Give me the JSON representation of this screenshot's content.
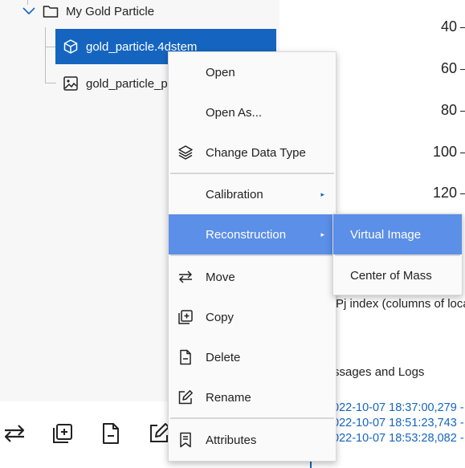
{
  "tree": {
    "root_label": "My Gold Particle",
    "items": [
      {
        "label": "gold_particle.4dstem",
        "icon": "cube-icon",
        "selected": true
      },
      {
        "label": "gold_particle_pr",
        "icon": "image-icon",
        "selected": false
      }
    ]
  },
  "toolbar": {
    "buttons": [
      {
        "icon": "move-arrows-icon"
      },
      {
        "icon": "copy-add-icon"
      },
      {
        "icon": "delete-file-icon"
      },
      {
        "icon": "rename-pen-icon"
      }
    ]
  },
  "axis": {
    "ticks": [
      "40",
      "60",
      "80",
      "100",
      "120"
    ],
    "caption": "Pj index (columns of loca"
  },
  "messages": {
    "title": "ssages and Logs",
    "lines": [
      "022-10-07 18:37:00,279 -",
      "022-10-07 18:51:23,743 -",
      "022-10-07 18:53:28,082 -"
    ]
  },
  "context_menu": {
    "items": [
      {
        "label": "Open",
        "icon": "",
        "submenu": false
      },
      {
        "label": "Open As...",
        "icon": "",
        "submenu": false
      },
      {
        "label": "Change Data Type",
        "icon": "layers-icon",
        "submenu": false
      },
      {
        "label": "Calibration",
        "icon": "",
        "submenu": true
      },
      {
        "label": "Reconstruction",
        "icon": "",
        "submenu": true,
        "active": true
      },
      {
        "label": "Move",
        "icon": "move-arrows-icon",
        "submenu": false
      },
      {
        "label": "Copy",
        "icon": "copy-add-icon",
        "submenu": false
      },
      {
        "label": "Delete",
        "icon": "delete-file-icon",
        "submenu": false
      },
      {
        "label": "Rename",
        "icon": "rename-pen-icon",
        "submenu": false
      },
      {
        "label": "Attributes",
        "icon": "bookmark-icon",
        "submenu": false
      }
    ],
    "submenu_arrow": "▸"
  },
  "sub_menu": {
    "items": [
      {
        "label": "Virtual Image",
        "active": true
      },
      {
        "label": "Center of Mass",
        "active": false
      }
    ]
  },
  "colors": {
    "selection": "#1565c0",
    "menu_highlight": "#5b8fe8",
    "link_blue": "#1565c0"
  }
}
